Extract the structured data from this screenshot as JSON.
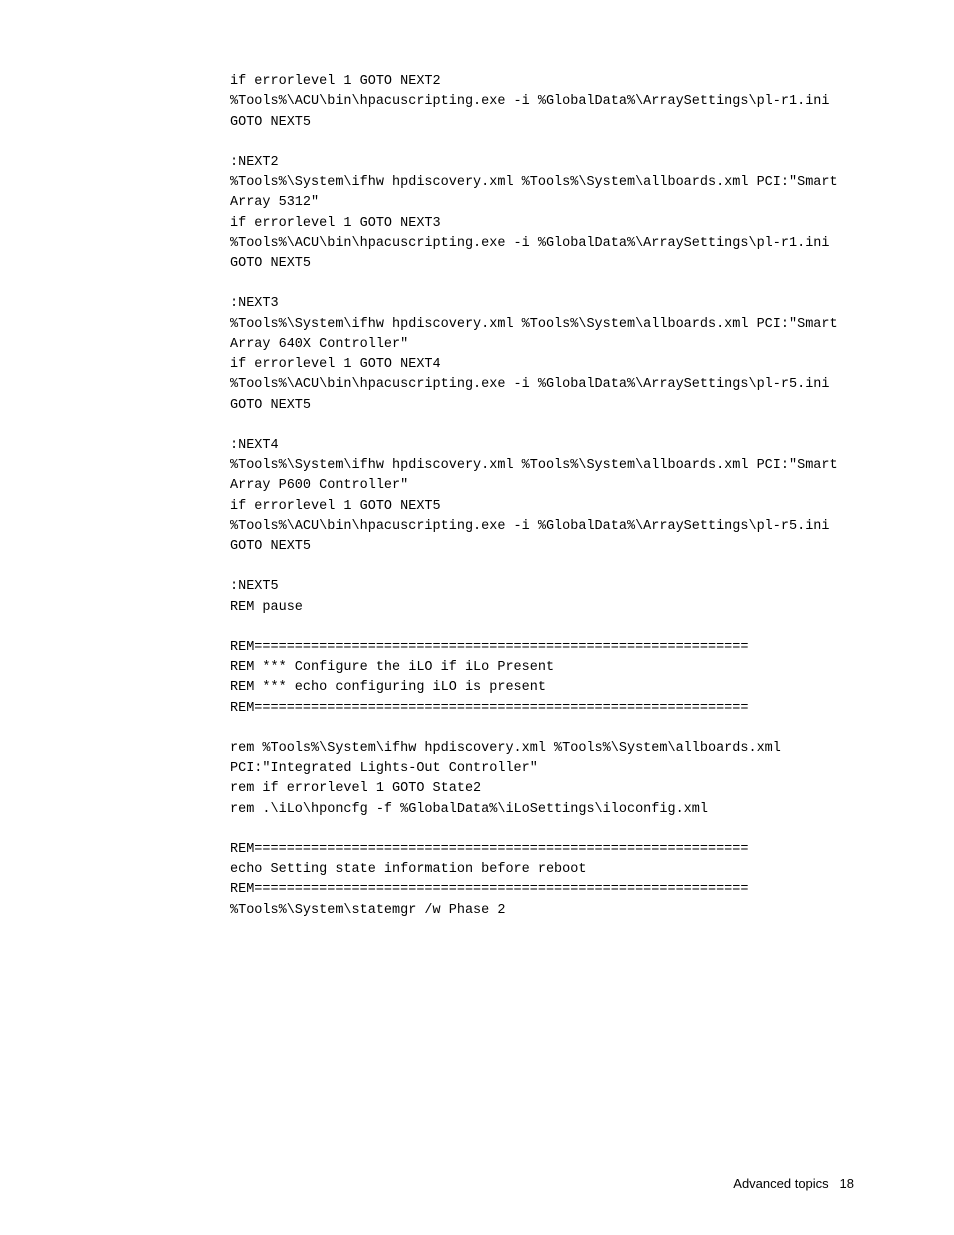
{
  "blocks": [
    "if errorlevel 1 GOTO NEXT2\n%Tools%\\ACU\\bin\\hpacuscripting.exe -i %GlobalData%\\ArraySettings\\pl-r1.ini\nGOTO NEXT5",
    ":NEXT2\n%Tools%\\System\\ifhw hpdiscovery.xml %Tools%\\System\\allboards.xml PCI:\"Smart Array 5312\"\nif errorlevel 1 GOTO NEXT3\n%Tools%\\ACU\\bin\\hpacuscripting.exe -i %GlobalData%\\ArraySettings\\pl-r1.ini\nGOTO NEXT5",
    ":NEXT3\n%Tools%\\System\\ifhw hpdiscovery.xml %Tools%\\System\\allboards.xml PCI:\"Smart Array 640X Controller\"\nif errorlevel 1 GOTO NEXT4\n%Tools%\\ACU\\bin\\hpacuscripting.exe -i %GlobalData%\\ArraySettings\\pl-r5.ini\nGOTO NEXT5",
    ":NEXT4\n%Tools%\\System\\ifhw hpdiscovery.xml %Tools%\\System\\allboards.xml PCI:\"Smart Array P600 Controller\"\nif errorlevel 1 GOTO NEXT5\n%Tools%\\ACU\\bin\\hpacuscripting.exe -i %GlobalData%\\ArraySettings\\pl-r5.ini\nGOTO NEXT5",
    ":NEXT5\nREM pause",
    "REM=============================================================\nREM *** Configure the iLO if iLo Present\nREM *** echo configuring iLO is present\nREM=============================================================",
    "rem %Tools%\\System\\ifhw hpdiscovery.xml %Tools%\\System\\allboards.xml PCI:\"Integrated Lights-Out Controller\"\nrem if errorlevel 1 GOTO State2\nrem .\\iLo\\hponcfg -f %GlobalData%\\iLoSettings\\iloconfig.xml",
    "REM=============================================================\necho Setting state information before reboot\nREM=============================================================\n%Tools%\\System\\statemgr /w Phase 2"
  ],
  "footer": {
    "label": "Advanced topics",
    "page_number": "18"
  }
}
